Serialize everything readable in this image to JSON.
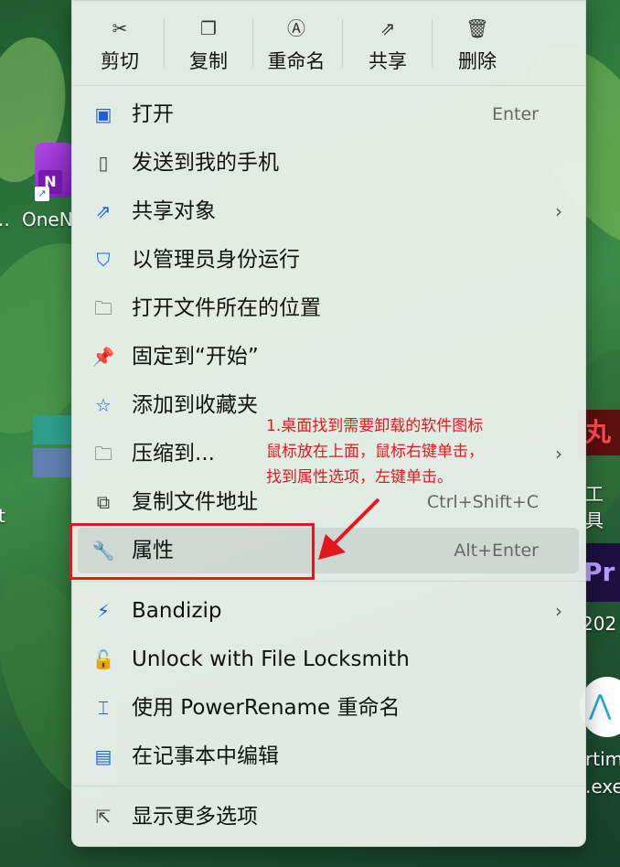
{
  "desktop": {
    "left_icon_label": "OneN",
    "left_icon_prefix": "..",
    "left_letter": "t",
    "right_tile1_text": "丸",
    "right_label1": "工具",
    "right_tile2_text": "Pr",
    "right_label2": "202",
    "right_label3": "rtim",
    "right_label4": ".exe"
  },
  "toolbar": [
    {
      "label": "剪切",
      "icon": "cut-icon"
    },
    {
      "label": "复制",
      "icon": "copy-icon"
    },
    {
      "label": "重命名",
      "icon": "rename-icon"
    },
    {
      "label": "共享",
      "icon": "share-icon"
    },
    {
      "label": "删除",
      "icon": "delete-icon"
    }
  ],
  "menu": {
    "items": [
      {
        "label": "打开",
        "shortcut": "Enter",
        "icon": "open-icon"
      },
      {
        "label": "发送到我的手机",
        "icon": "phone-icon"
      },
      {
        "label": "共享对象",
        "icon": "share-icon",
        "submenu": true
      },
      {
        "label": "以管理员身份运行",
        "icon": "admin-shield-icon"
      },
      {
        "label": "打开文件所在的位置",
        "icon": "folder-icon"
      },
      {
        "label": "固定到“开始”",
        "icon": "pin-icon"
      },
      {
        "label": "添加到收藏夹",
        "icon": "star-icon"
      },
      {
        "label": "压缩到...",
        "icon": "zip-folder-icon",
        "submenu": true
      },
      {
        "label": "复制文件地址",
        "shortcut": "Ctrl+Shift+C",
        "icon": "path-icon"
      },
      {
        "label": "属性",
        "shortcut": "Alt+Enter",
        "icon": "wrench-icon"
      },
      {
        "label": "Bandizip",
        "icon": "bandizip-icon",
        "submenu": true
      },
      {
        "label": "Unlock with File Locksmith",
        "icon": "lock-icon"
      },
      {
        "label": "使用 PowerRename 重命名",
        "icon": "powerrename-icon"
      },
      {
        "label": "在记事本中编辑",
        "icon": "notepad-icon"
      },
      {
        "label": "显示更多选项",
        "icon": "more-options-icon"
      }
    ]
  },
  "annotation": {
    "text": "1.桌面找到需要卸载的软件图标\n鼠标放在上面，鼠标右键单击，\n找到属性选项，左键单击。",
    "color": "#e3171d"
  }
}
